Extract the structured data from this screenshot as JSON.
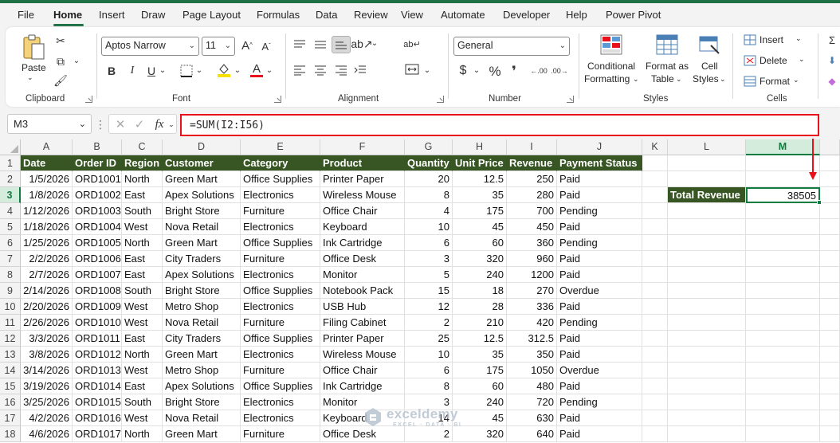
{
  "menu": [
    {
      "label": "File",
      "active": false
    },
    {
      "label": "Home",
      "active": true
    },
    {
      "label": "Insert",
      "active": false
    },
    {
      "label": "Draw",
      "active": false
    },
    {
      "label": "Page Layout",
      "active": false
    },
    {
      "label": "Formulas",
      "active": false
    },
    {
      "label": "Data",
      "active": false
    },
    {
      "label": "Review",
      "active": false
    },
    {
      "label": "View",
      "active": false
    },
    {
      "label": "Automate",
      "active": false
    },
    {
      "label": "Developer",
      "active": false
    },
    {
      "label": "Help",
      "active": false
    },
    {
      "label": "Power Pivot",
      "active": false
    }
  ],
  "ribbon": {
    "clipboard": {
      "paste": "Paste",
      "label": "Clipboard"
    },
    "font": {
      "name": "Aptos Narrow",
      "size": "11",
      "label": "Font"
    },
    "alignment": {
      "label": "Alignment"
    },
    "number": {
      "format": "General",
      "label": "Number"
    },
    "styles": {
      "conditional_1": "Conditional",
      "conditional_2": "Formatting",
      "format_table_1": "Format as",
      "format_table_2": "Table",
      "cell_styles_1": "Cell",
      "cell_styles_2": "Styles",
      "label": "Styles"
    },
    "cells": {
      "insert": "Insert",
      "delete": "Delete",
      "format": "Format",
      "label": "Cells"
    }
  },
  "formula_bar": {
    "name_box": "M3",
    "formula": "=SUM(I2:I56)"
  },
  "columns": [
    "A",
    "B",
    "C",
    "D",
    "E",
    "F",
    "G",
    "H",
    "I",
    "J",
    "K",
    "L",
    "M"
  ],
  "headers": [
    "Date",
    "Order ID",
    "Region",
    "Customer",
    "Category",
    "Product",
    "Quantity",
    "Unit Price",
    "Revenue",
    "Payment Status"
  ],
  "rows": [
    [
      "1/5/2026",
      "ORD1001",
      "North",
      "Green Mart",
      "Office Supplies",
      "Printer Paper",
      "20",
      "12.5",
      "250",
      "Paid"
    ],
    [
      "1/8/2026",
      "ORD1002",
      "East",
      "Apex Solutions",
      "Electronics",
      "Wireless Mouse",
      "8",
      "35",
      "280",
      "Paid"
    ],
    [
      "1/12/2026",
      "ORD1003",
      "South",
      "Bright Store",
      "Furniture",
      "Office Chair",
      "4",
      "175",
      "700",
      "Pending"
    ],
    [
      "1/18/2026",
      "ORD1004",
      "West",
      "Nova Retail",
      "Electronics",
      "Keyboard",
      "10",
      "45",
      "450",
      "Paid"
    ],
    [
      "1/25/2026",
      "ORD1005",
      "North",
      "Green Mart",
      "Office Supplies",
      "Ink Cartridge",
      "6",
      "60",
      "360",
      "Pending"
    ],
    [
      "2/2/2026",
      "ORD1006",
      "East",
      "City Traders",
      "Furniture",
      "Office Desk",
      "3",
      "320",
      "960",
      "Paid"
    ],
    [
      "2/7/2026",
      "ORD1007",
      "East",
      "Apex Solutions",
      "Electronics",
      "Monitor",
      "5",
      "240",
      "1200",
      "Paid"
    ],
    [
      "2/14/2026",
      "ORD1008",
      "South",
      "Bright Store",
      "Office Supplies",
      "Notebook Pack",
      "15",
      "18",
      "270",
      "Overdue"
    ],
    [
      "2/20/2026",
      "ORD1009",
      "West",
      "Metro Shop",
      "Electronics",
      "USB Hub",
      "12",
      "28",
      "336",
      "Paid"
    ],
    [
      "2/26/2026",
      "ORD1010",
      "West",
      "Nova Retail",
      "Furniture",
      "Filing Cabinet",
      "2",
      "210",
      "420",
      "Pending"
    ],
    [
      "3/3/2026",
      "ORD1011",
      "East",
      "City Traders",
      "Office Supplies",
      "Printer Paper",
      "25",
      "12.5",
      "312.5",
      "Paid"
    ],
    [
      "3/8/2026",
      "ORD1012",
      "North",
      "Green Mart",
      "Electronics",
      "Wireless Mouse",
      "10",
      "35",
      "350",
      "Paid"
    ],
    [
      "3/14/2026",
      "ORD1013",
      "West",
      "Metro Shop",
      "Furniture",
      "Office Chair",
      "6",
      "175",
      "1050",
      "Overdue"
    ],
    [
      "3/19/2026",
      "ORD1014",
      "East",
      "Apex Solutions",
      "Office Supplies",
      "Ink Cartridge",
      "8",
      "60",
      "480",
      "Paid"
    ],
    [
      "3/25/2026",
      "ORD1015",
      "South",
      "Bright Store",
      "Electronics",
      "Monitor",
      "3",
      "240",
      "720",
      "Pending"
    ],
    [
      "4/2/2026",
      "ORD1016",
      "West",
      "Nova Retail",
      "Electronics",
      "Keyboard",
      "14",
      "45",
      "630",
      "Paid"
    ],
    [
      "4/6/2026",
      "ORD1017",
      "North",
      "Green Mart",
      "Furniture",
      "Office Desk",
      "2",
      "320",
      "640",
      "Paid"
    ]
  ],
  "summary": {
    "label": "Total Revenue",
    "value": "38505"
  },
  "watermark": {
    "main": "exceldemy",
    "sub": "EXCEL · DATA · BI"
  },
  "colors": {
    "accent": "#107c41",
    "header_fill": "#375623",
    "highlight": "#e8111b"
  }
}
